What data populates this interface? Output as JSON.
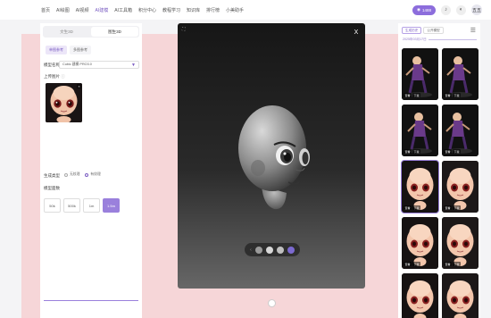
{
  "nav": {
    "items": [
      "首页",
      "AI绘图",
      "AI视频",
      "AI建模",
      "AI工具箱",
      "积分中心",
      "教程学习",
      "知识库",
      "排行榜",
      "小美助手"
    ],
    "active_index": 3,
    "points": "1488",
    "avatar_text": "五五"
  },
  "left_panel": {
    "mode_tabs": [
      "文生3D",
      "图生3D"
    ],
    "active_mode": 1,
    "ref_tabs": [
      "单图参考",
      "多图参考"
    ],
    "active_ref": 0,
    "model_label": "模型名称",
    "model_value": "Cubic 建模 PRO3.0",
    "upload_label": "上传图片",
    "gen_type_label": "生成类型",
    "gen_types": [
      "无纹理",
      "有纹理"
    ],
    "active_gen_type": 1,
    "face_label": "模型面数",
    "face_counts": [
      "50k",
      "500k",
      "1m",
      "1.5m"
    ],
    "active_face": 3
  },
  "viewer": {
    "close": "X",
    "materials": [
      {
        "color": "#9a9a9a"
      },
      {
        "color": "#d8d8d8"
      },
      {
        "color": "#c0c0c0"
      },
      {
        "color": "#7c6ad0"
      }
    ]
  },
  "right_panel": {
    "tabs": [
      "生成历史",
      "公开模型"
    ],
    "active_tab": 0,
    "section_label": "2025年03月17日",
    "cards": [
      {
        "tags": [
          "查看",
          "下载"
        ],
        "kind": "figure",
        "selected": false
      },
      {
        "tags": [
          "查看",
          "下载"
        ],
        "kind": "figure",
        "selected": false
      },
      {
        "tags": [
          "查看",
          "下载"
        ],
        "kind": "figure",
        "selected": false
      },
      {
        "tags": [
          "查看",
          "下载"
        ],
        "kind": "figure",
        "selected": false
      },
      {
        "tags": [
          "查看",
          "下载"
        ],
        "kind": "head",
        "selected": true
      },
      {
        "tags": [
          "查看",
          "下载"
        ],
        "kind": "head",
        "selected": false
      },
      {
        "tags": [
          "查看",
          "下载"
        ],
        "kind": "head",
        "selected": false
      },
      {
        "tags": [
          "查看",
          "下载"
        ],
        "kind": "head",
        "selected": false
      },
      {
        "tags": [],
        "kind": "head",
        "selected": false
      },
      {
        "tags": [],
        "kind": "head",
        "selected": false
      }
    ]
  }
}
